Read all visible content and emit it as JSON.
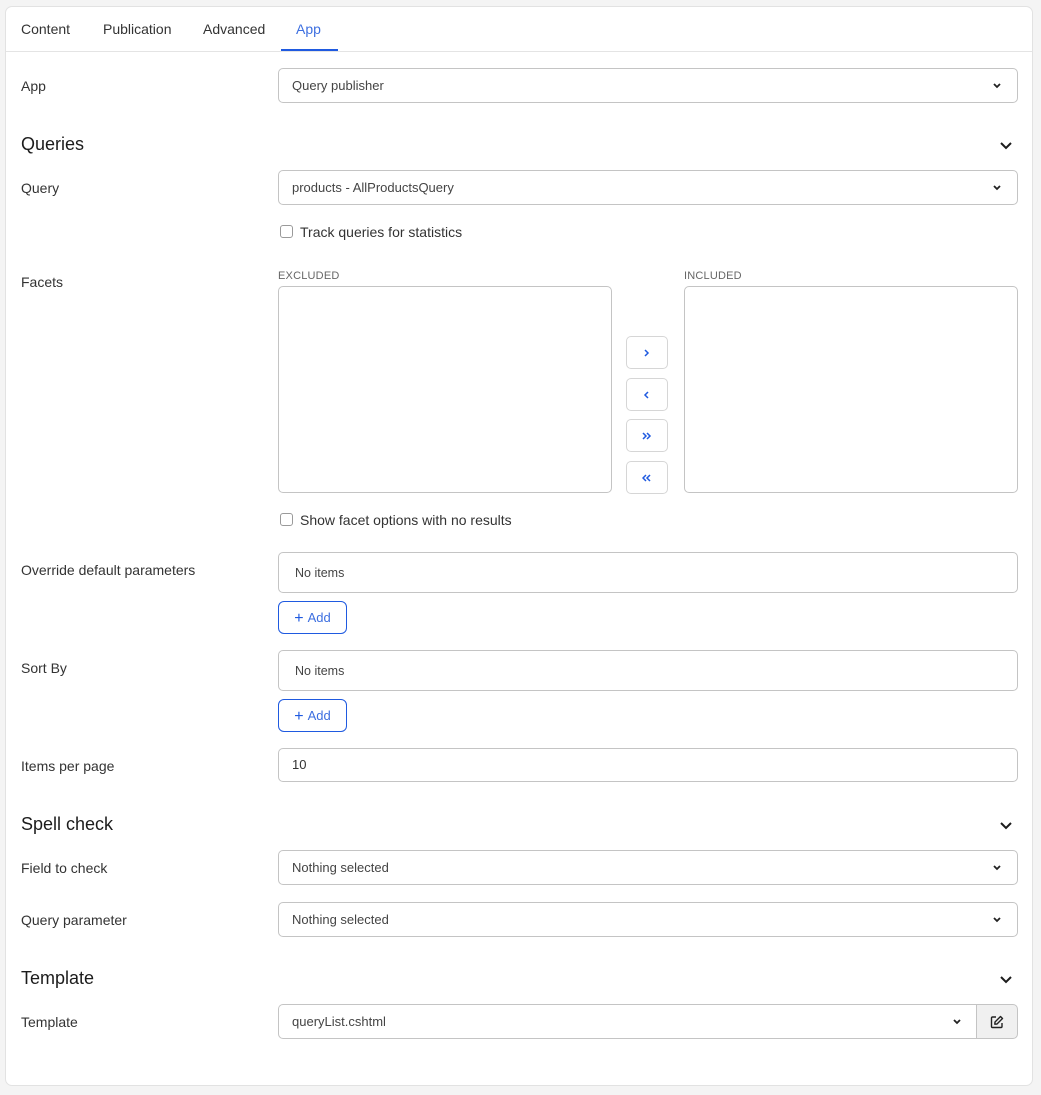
{
  "tabs": [
    {
      "label": "Content",
      "active": false
    },
    {
      "label": "Publication",
      "active": false
    },
    {
      "label": "Advanced",
      "active": false
    },
    {
      "label": "App",
      "active": true
    }
  ],
  "app": {
    "label": "App",
    "value": "Query publisher"
  },
  "queries": {
    "heading": "Queries",
    "query": {
      "label": "Query",
      "value": "products - AllProductsQuery"
    },
    "track_queries": {
      "label": "Track queries for statistics",
      "checked": false
    },
    "facets": {
      "label": "Facets",
      "excluded_label": "EXCLUDED",
      "included_label": "INCLUDED",
      "excluded_items": [],
      "included_items": [],
      "buttons": {
        "move_right": "›",
        "move_left": "‹",
        "move_all_right": "»",
        "move_all_left": "«"
      }
    },
    "show_facet_options": {
      "label": "Show facet options with no results",
      "checked": false
    },
    "override_params": {
      "label": "Override default parameters",
      "empty_text": "No items",
      "add_label": "Add"
    },
    "sort_by": {
      "label": "Sort By",
      "empty_text": "No items",
      "add_label": "Add"
    },
    "items_per_page": {
      "label": "Items per page",
      "value": "10"
    }
  },
  "spell_check": {
    "heading": "Spell check",
    "field_to_check": {
      "label": "Field to check",
      "value": "Nothing selected"
    },
    "query_parameter": {
      "label": "Query parameter",
      "value": "Nothing selected"
    }
  },
  "template": {
    "heading": "Template",
    "template_field": {
      "label": "Template",
      "value": "queryList.cshtml"
    }
  },
  "colors": {
    "accent": "#1f5ae0",
    "active_tab_text": "#3d6fe0",
    "border": "#c4c4c4",
    "background": "#f4f4f4"
  }
}
